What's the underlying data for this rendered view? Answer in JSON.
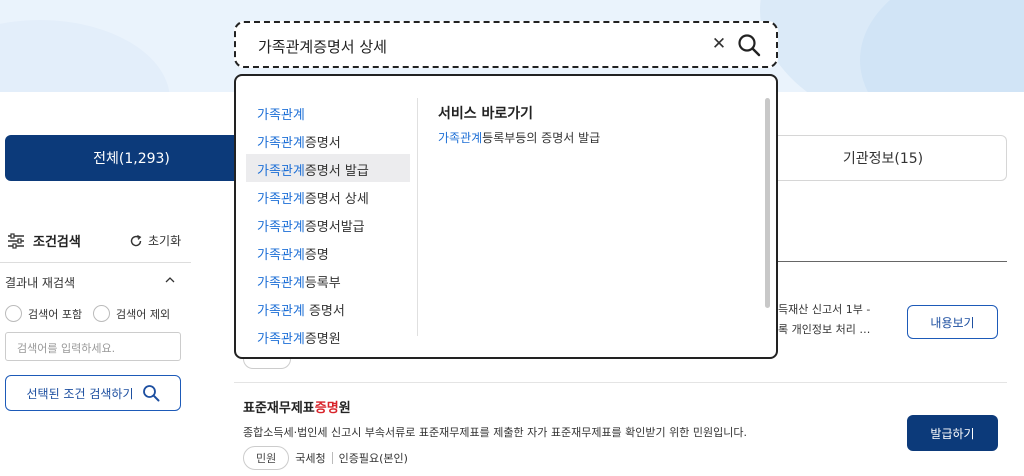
{
  "search": {
    "query": "가족관계증명서 상세",
    "clear_icon": "close-icon",
    "submit_icon": "search-icon"
  },
  "dropdown": {
    "keyword": "가족관계",
    "suggestions": [
      {
        "kw": "가족관계",
        "rest": ""
      },
      {
        "kw": "가족관계",
        "rest": "증명서"
      },
      {
        "kw": "가족관계",
        "rest": "증명서 발급"
      },
      {
        "kw": "가족관계",
        "rest": "증명서 상세"
      },
      {
        "kw": "가족관계",
        "rest": "증명서발급"
      },
      {
        "kw": "가족관계",
        "rest": "증명"
      },
      {
        "kw": "가족관계",
        "rest": "등록부"
      },
      {
        "kw": "가족관계",
        "rest": " 증명서"
      },
      {
        "kw": "가족관계",
        "rest": "증명원"
      }
    ],
    "service_title": "서비스 바로가기",
    "service_link": {
      "kw": "가족관계",
      "rest": "등록부등의 증명서 발급"
    }
  },
  "tabs": {
    "all": "전체(1,293)",
    "org": "기관정보(15)"
  },
  "filters": {
    "title": "조건검색",
    "reset": "초기화",
    "research_label": "결과내 재검색",
    "include_label": "검색어 포함",
    "exclude_label": "검색어 제외",
    "input_placeholder": "검색어를 입력하세요.",
    "apply_label": "선택된 조건 검색하기"
  },
  "results": [
    {
      "desc_line1": "득재산 신고서 1부 -",
      "desc_line2": "록 개인정보 처리 …",
      "button": "내용보기"
    },
    {
      "title_pre": "표준재무제표",
      "title_hl": "증명",
      "title_post": "원",
      "desc": "종합소득세·법인세 신고시 부속서류로 표준재무제표를 제출한 자가 표준재무제표를 확인받기 위한 민원입니다.",
      "type_tag": "민원",
      "agency": "국세청",
      "auth": "인증필요(본인)",
      "button": "발급하기"
    }
  ],
  "colors": {
    "primary": "#0c3a7a",
    "keyword": "#1d6fd6",
    "highlight": "#d8232a"
  }
}
